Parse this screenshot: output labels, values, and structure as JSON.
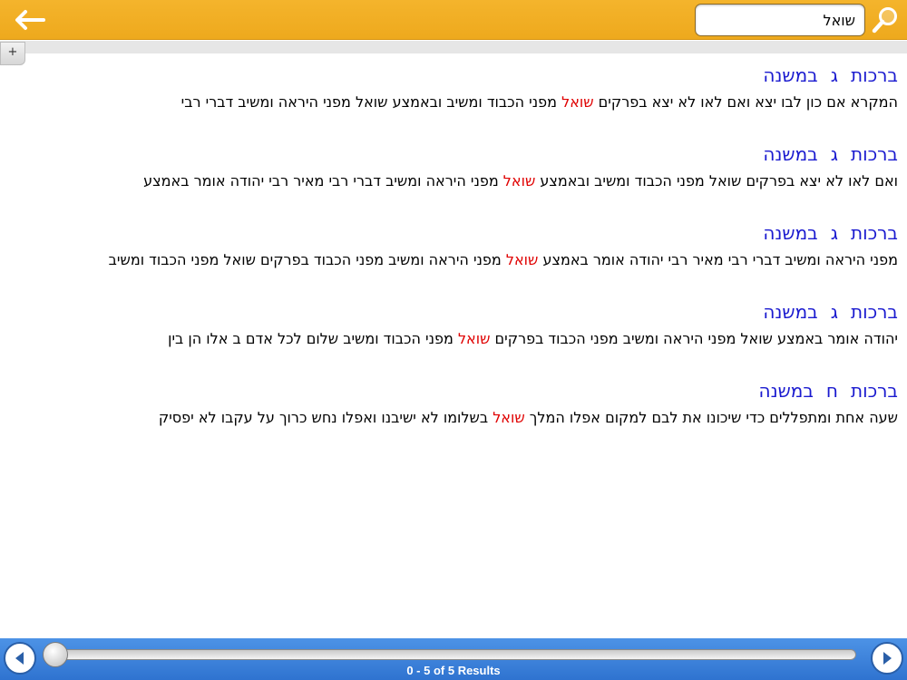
{
  "search": {
    "query": "שואל"
  },
  "toolbar": {
    "expand_label": "+"
  },
  "results": [
    {
      "book": "ברכות",
      "chapter": "ג",
      "source": "במשנה",
      "text_before": "המקרא אם כון לבו יצא ואם לאו לא יצא בפרקים ",
      "hit": "שואל",
      "text_after": " מפני הכבוד ומשיב ובאמצע שואל מפני היראה ומשיב דברי רבי"
    },
    {
      "book": "ברכות",
      "chapter": "ג",
      "source": "במשנה",
      "text_before": "ואם לאו לא יצא בפרקים שואל מפני הכבוד ומשיב ובאמצע ",
      "hit": "שואל",
      "text_after": " מפני היראה ומשיב דברי רבי מאיר רבי יהודה אומר באמצע"
    },
    {
      "book": "ברכות",
      "chapter": "ג",
      "source": "במשנה",
      "text_before": "מפני היראה ומשיב דברי רבי מאיר רבי יהודה אומר באמצע ",
      "hit": "שואל",
      "text_after": " מפני היראה ומשיב מפני הכבוד בפרקים שואל מפני הכבוד ומשיב"
    },
    {
      "book": "ברכות",
      "chapter": "ג",
      "source": "במשנה",
      "text_before": "יהודה אומר באמצע שואל מפני היראה ומשיב מפני הכבוד בפרקים ",
      "hit": "שואל",
      "text_after": " מפני הכבוד ומשיב שלום לכל אדם ב אלו הן בין"
    },
    {
      "book": "ברכות",
      "chapter": "ח",
      "source": "במשנה",
      "text_before": "שעה אחת ומתפללים כדי שיכונו את לבם למקום אפלו המלך ",
      "hit": "שואל",
      "text_after": " בשלומו לא ישיבנו ואפלו נחש כרוך על עקבו לא יפסיק"
    }
  ],
  "footer": {
    "results_count": "0 - 5 of 5 Results",
    "slider_position": 0
  },
  "colors": {
    "topbar": "#f2b023",
    "bottombar": "#3a80db",
    "title": "#1a1acf",
    "hit": "#e00000"
  }
}
